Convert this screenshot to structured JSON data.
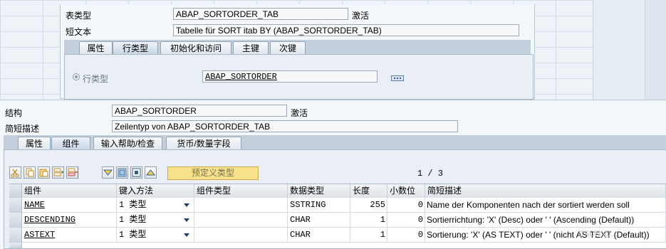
{
  "upper": {
    "table_type_label": "表类型",
    "table_type_value": "ABAP_SORTORDER_TAB",
    "table_type_status": "激活",
    "short_text_label": "短文本",
    "short_text_value": "Tabelle für SORT itab BY (ABAP_SORTORDER_TAB)",
    "tabs": [
      {
        "label": "属性"
      },
      {
        "label": "行类型"
      },
      {
        "label": "初始化和访问"
      },
      {
        "label": "主键"
      },
      {
        "label": "次键"
      }
    ],
    "row_type_radio_label": "行类型",
    "row_type_value": "ABAP_SORTORDER"
  },
  "lower": {
    "structure_label": "结构",
    "structure_value": "ABAP_SORTORDER",
    "structure_status": "激活",
    "desc_label": "简短描述",
    "desc_value": "Zeilentyp von ABAP_SORTORDER_TAB",
    "tabs": [
      {
        "label": "属性"
      },
      {
        "label": "组件"
      },
      {
        "label": "输入帮助/检查"
      },
      {
        "label": "货币/数量字段"
      }
    ],
    "predefined_type_button": "预定义类型",
    "page_indicator": "1 / 3",
    "columns": [
      "组件",
      "键入方法",
      "组件类型",
      "数据类型",
      "长度",
      "小数位",
      "简短描述"
    ],
    "rows": [
      {
        "component": "NAME",
        "typing": "1 类型",
        "comp_type": "",
        "data_type": "SSTRING",
        "length": "255",
        "decimals": "0",
        "description": "Name der Komponenten nach der sortiert werden soll"
      },
      {
        "component": "DESCENDING",
        "typing": "1 类型",
        "comp_type": "",
        "data_type": "CHAR",
        "length": "1",
        "decimals": "0",
        "description": "Sortierrichtung: 'X' (Desc) oder '  ' (Ascending (Default))"
      },
      {
        "component": "ASTEXT",
        "typing": "1 类型",
        "comp_type": "",
        "data_type": "CHAR",
        "length": "1",
        "decimals": "0",
        "description": "Sortierung: 'X' (AS TEXT) oder ' ' (nicht AS TEXT (Default))"
      }
    ],
    "watermark": "CSDN @..."
  },
  "colors": {
    "accent_yellow": "#f5e28b",
    "tab_blue": "#c8d6e4"
  }
}
